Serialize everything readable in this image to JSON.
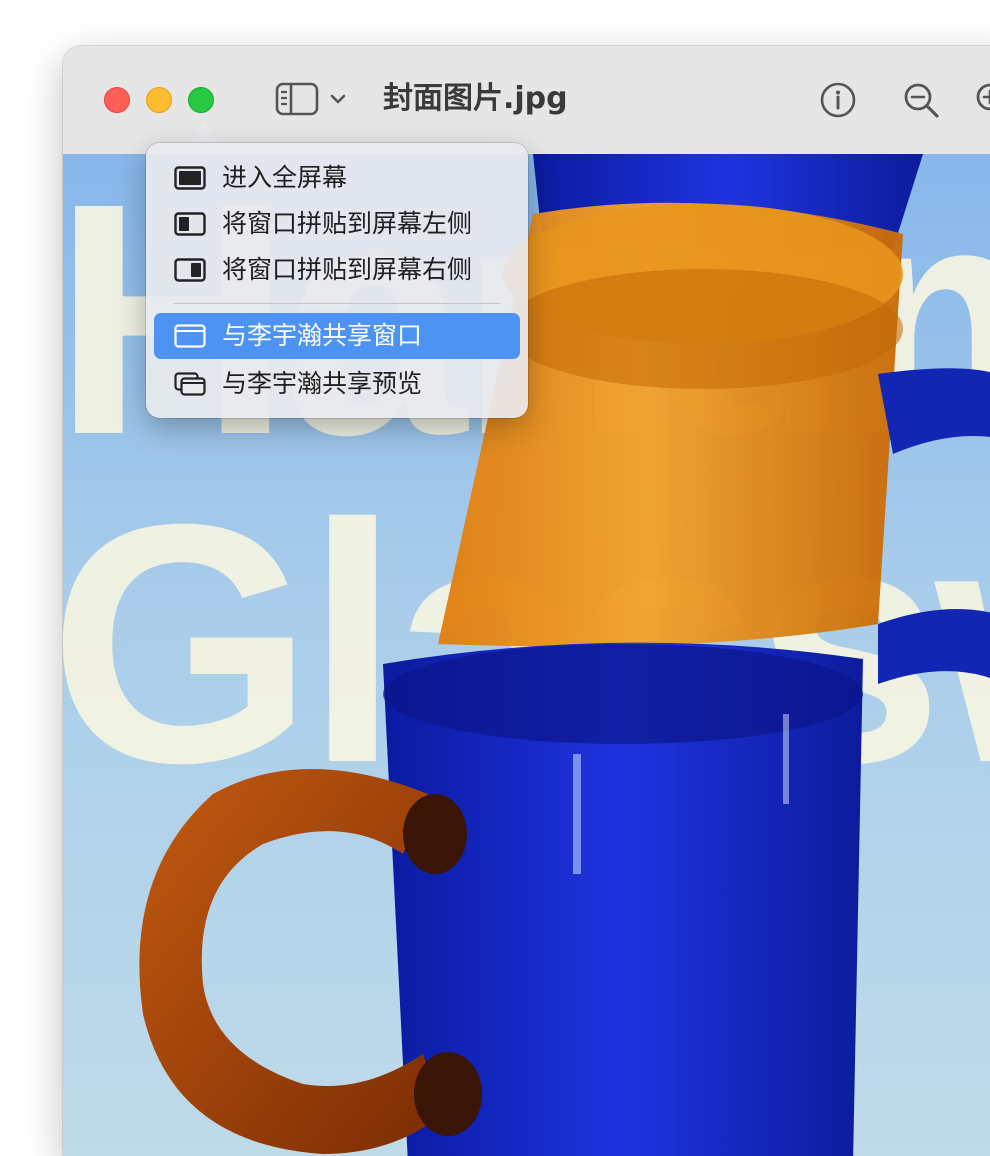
{
  "window": {
    "title": "封面图片.jpg",
    "controls": {
      "close": "close-button",
      "minimize": "minimize-button",
      "zoom": "zoom-button"
    }
  },
  "toolbar": {
    "icons": [
      "sidebar-icon",
      "chevron-down-icon",
      "info-icon",
      "zoom-out-icon",
      "zoom-in-icon"
    ]
  },
  "background_image": {
    "words": [
      "Handm",
      "Glassw"
    ]
  },
  "menu": {
    "items": [
      {
        "label": "进入全屏幕",
        "icon": "fullscreen-icon",
        "highlighted": false
      },
      {
        "label": "将窗口拼贴到屏幕左侧",
        "icon": "tile-left-icon",
        "highlighted": false
      },
      {
        "label": "将窗口拼贴到屏幕右侧",
        "icon": "tile-right-icon",
        "highlighted": false
      },
      {
        "label": "与李宇瀚共享窗口",
        "icon": "share-window-icon",
        "highlighted": true
      },
      {
        "label": "与李宇瀚共享预览",
        "icon": "share-preview-icon",
        "highlighted": false
      }
    ]
  },
  "colors": {
    "highlight": "#4c93f4",
    "close": "#fe5f57",
    "minimize": "#febc2e",
    "zoom": "#28c840"
  }
}
